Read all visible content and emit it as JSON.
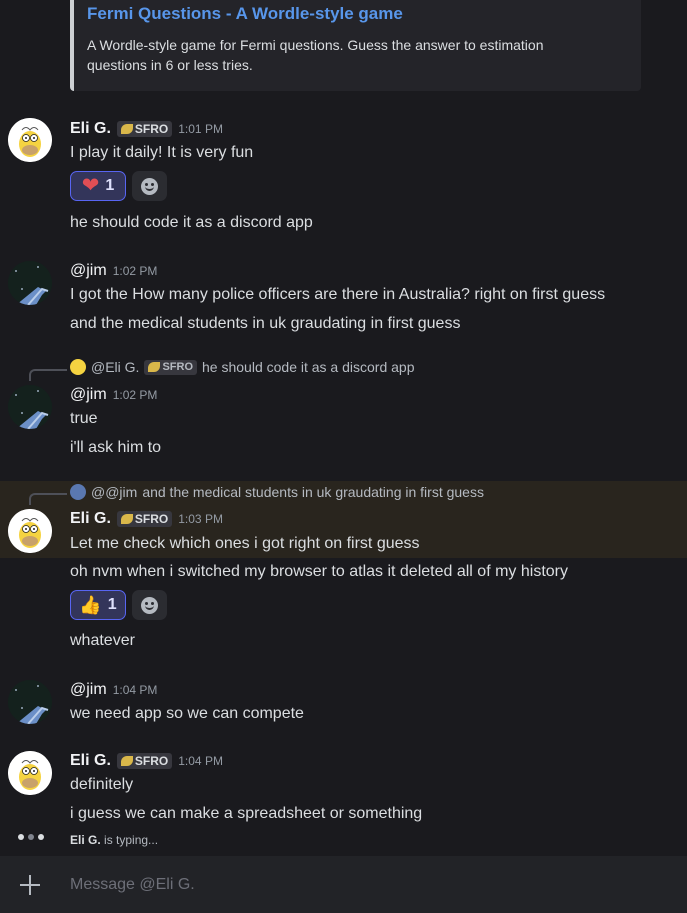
{
  "embed": {
    "title": "Fermi Questions - A Wordle-style game",
    "description": "A Wordle-style game for Fermi questions. Guess the answer to estimation questions in 6 or less tries."
  },
  "users": {
    "eli": {
      "name": "Eli G.",
      "tag": "SFRO"
    },
    "jim": {
      "name": "@jim"
    }
  },
  "messages": [
    {
      "author": "Eli G.",
      "time": "1:01 PM",
      "lines": [
        "I play it daily! It is very fun",
        "he should code it as a discord app"
      ],
      "reaction": {
        "emoji": "heart",
        "count": "1"
      }
    },
    {
      "author": "@jim",
      "time": "1:02 PM",
      "lines": [
        "I got the How many police officers are there in Australia? right on first guess",
        "and the medical students in uk graudating in first guess"
      ]
    },
    {
      "author": "@jim",
      "time": "1:02 PM",
      "reply": {
        "name": "@Eli G.",
        "tag": "SFRO",
        "text": "he should code it as a discord app"
      },
      "lines": [
        "true",
        "i'll ask him to"
      ]
    },
    {
      "author": "Eli G.",
      "time": "1:03 PM",
      "reply": {
        "name": "@@jim",
        "text": "and the medical students in uk graudating in first guess"
      },
      "lines": [
        "Let me check which ones i got right on first guess",
        "oh nvm when i switched my browser to atlas it deleted all of my history",
        "whatever"
      ],
      "reaction": {
        "emoji": "thumbs-up",
        "count": "1"
      }
    },
    {
      "author": "@jim",
      "time": "1:04 PM",
      "lines": [
        "we need app so we can compete"
      ]
    },
    {
      "author": "Eli G.",
      "time": "1:04 PM",
      "lines": [
        "definitely",
        "i guess we can make a spreadsheet or something"
      ]
    }
  ],
  "typing": {
    "name": "Eli G.",
    "text": " is typing..."
  },
  "composer": {
    "placeholder": "Message @Eli G."
  },
  "colors": {
    "background": "#1a1a1e",
    "link": "#5896ea",
    "reaction_border": "#5865f2",
    "highlight": "#29251e"
  }
}
